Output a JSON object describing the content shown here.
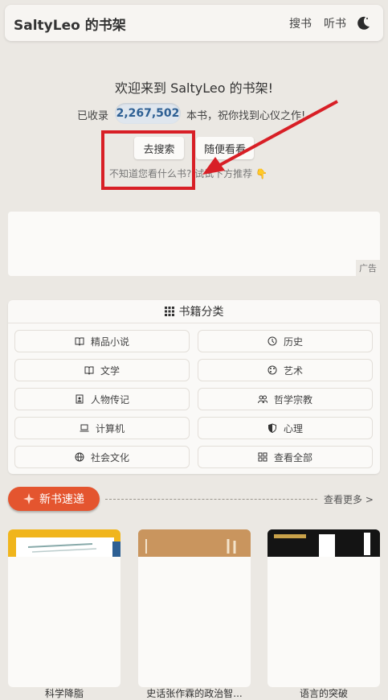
{
  "header": {
    "title": "SaltyLeo 的书架",
    "nav": [
      "搜书",
      "听书"
    ],
    "theme_icon": "moon-icon"
  },
  "hero": {
    "welcome": "欢迎来到 SaltyLeo 的书架!",
    "count_prefix": "已收录",
    "count": "2,267,502",
    "count_suffix": "本书，祝你找到心仪之作!",
    "search_button": "去搜索",
    "random_button": "随便看看",
    "hint": "不知道您看什么书? 试试下方推荐 👇"
  },
  "ad": {
    "label": "广告"
  },
  "categories": {
    "title": "书籍分类",
    "items": [
      {
        "label": "精品小说",
        "icon": "book-open-icon"
      },
      {
        "label": "历史",
        "icon": "clock-icon"
      },
      {
        "label": "文学",
        "icon": "book-open-icon"
      },
      {
        "label": "艺术",
        "icon": "palette-icon"
      },
      {
        "label": "人物传记",
        "icon": "id-card-icon"
      },
      {
        "label": "哲学宗教",
        "icon": "people-icon"
      },
      {
        "label": "计算机",
        "icon": "laptop-icon"
      },
      {
        "label": "心理",
        "icon": "shield-icon"
      },
      {
        "label": "社会文化",
        "icon": "globe-icon"
      },
      {
        "label": "查看全部",
        "icon": "grid-icon"
      }
    ]
  },
  "new_books": {
    "label": "新书速递",
    "see_more": "查看更多 >",
    "books": [
      {
        "title": "科学降脂"
      },
      {
        "title": "史话张作霖的政治智..."
      },
      {
        "title": "语言的突破"
      }
    ]
  },
  "colors": {
    "accent": "#e4552f",
    "count_badge": "#dfe6ee",
    "annotation_red": "#d81f26"
  }
}
